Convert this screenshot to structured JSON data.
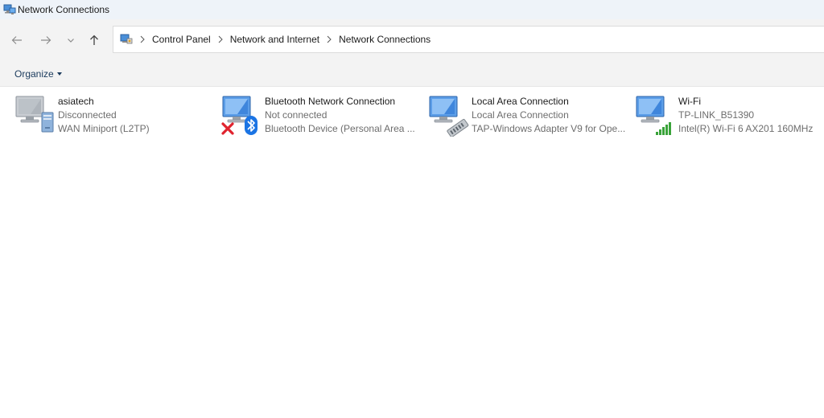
{
  "window": {
    "title": "Network Connections",
    "icon": "network-connections-icon"
  },
  "navigation": {
    "back_icon": "arrow-left-icon",
    "forward_icon": "arrow-right-icon",
    "recent_icon": "chevron-down-icon",
    "up_icon": "arrow-up-icon"
  },
  "breadcrumb": {
    "items": [
      "Control Panel",
      "Network and Internet",
      "Network Connections"
    ]
  },
  "toolbar": {
    "organize_label": "Organize"
  },
  "connections": [
    {
      "name": "asiatech",
      "status": "Disconnected",
      "device": "WAN Miniport (L2TP)",
      "icon": "vpn-connection-icon"
    },
    {
      "name": "Bluetooth Network Connection",
      "status": "Not connected",
      "device": "Bluetooth Device (Personal Area ...",
      "icon": "bluetooth-connection-icon"
    },
    {
      "name": "Local Area Connection",
      "status": "Local Area Connection",
      "device": "TAP-Windows Adapter V9 for Ope...",
      "icon": "ethernet-connection-icon"
    },
    {
      "name": "Wi-Fi",
      "status": "TP-LINK_B51390",
      "device": "Intel(R) Wi-Fi 6 AX201 160MHz",
      "icon": "wifi-connection-icon"
    }
  ],
  "colors": {
    "titlebar_bg": "#eef3f9",
    "toolbar_bg": "#f3f3f3",
    "secondary_text": "#6d6d6d",
    "organize_text": "#1a3a5c",
    "error_red": "#e0232e",
    "bluetooth_blue": "#1b74e4",
    "wifi_green": "#3aa33a"
  }
}
